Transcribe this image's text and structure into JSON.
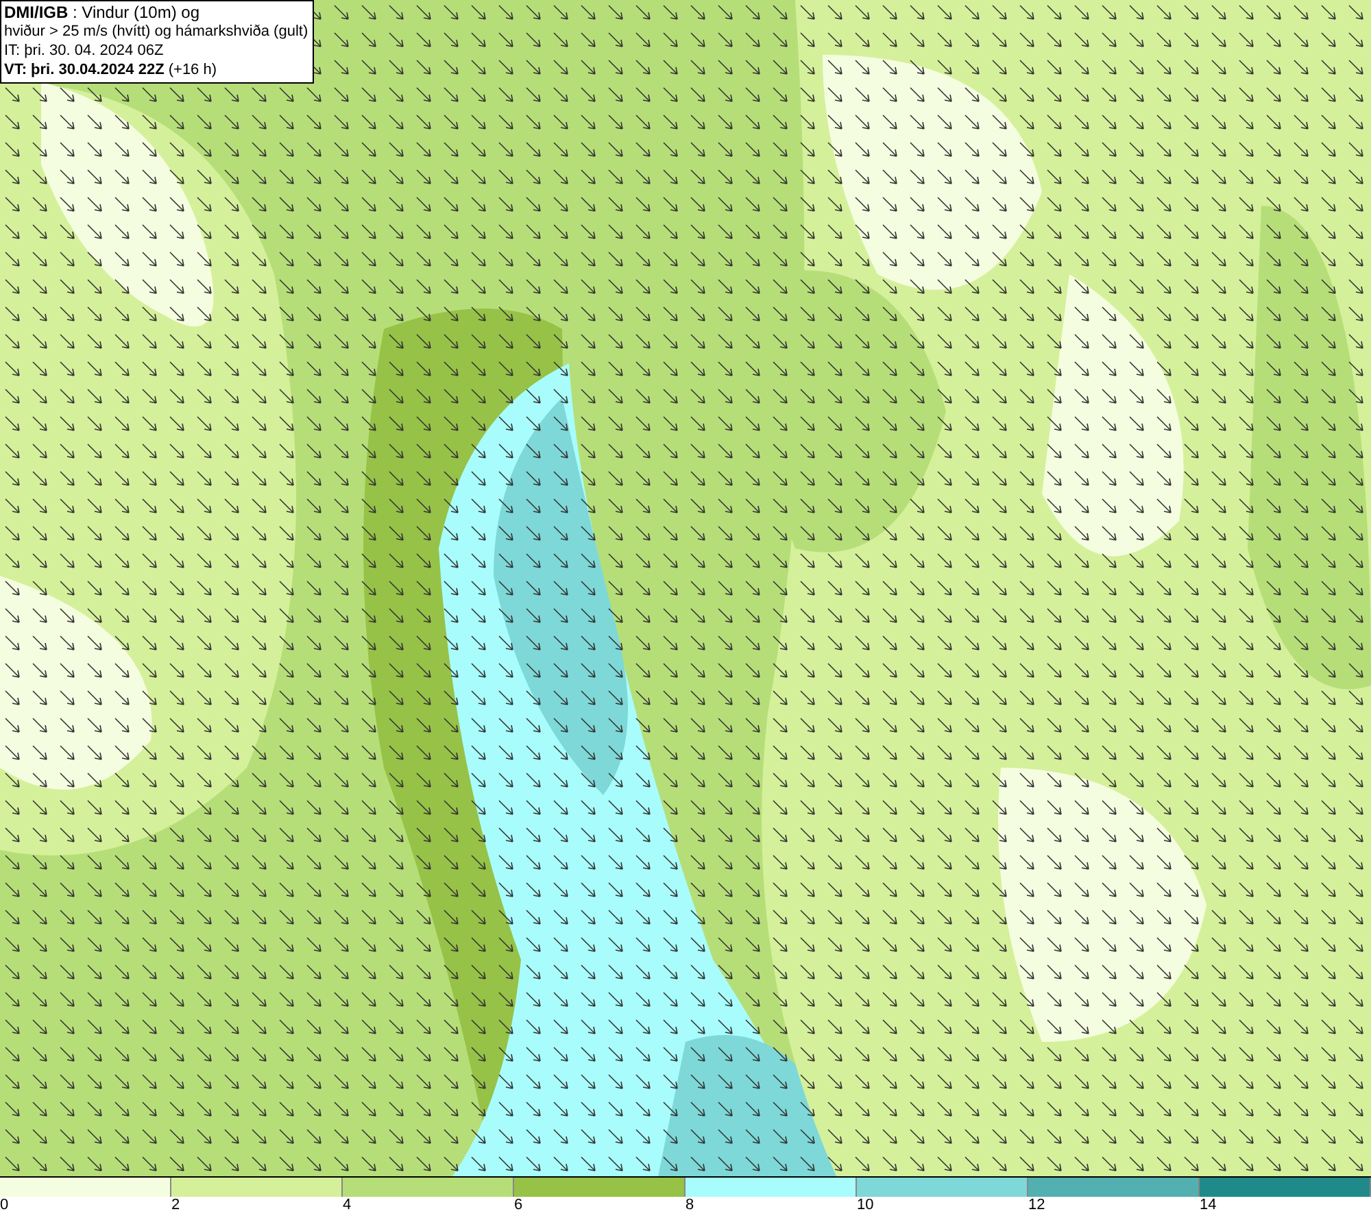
{
  "info_box": {
    "lines": [
      "**DMI/IGB** : Vindur (10m) og",
      "hviður > 25 m/s (hvítt) og hámarkshviða (gult)",
      "IT: þri. 30. 04. 2024 06Z",
      "**VT: þri. 30.04.2024 22Z** (+16 h)"
    ]
  },
  "legend": {
    "bins": [
      {
        "label": "0",
        "color": "#f5fde0"
      },
      {
        "label": "2",
        "color": "#d5f09a"
      },
      {
        "label": "4",
        "color": "#b6de78"
      },
      {
        "label": "6",
        "color": "#96c247"
      },
      {
        "label": "8",
        "color": "#a8fcfc"
      },
      {
        "label": "10",
        "color": "#7ed8d8"
      },
      {
        "label": "12",
        "color": "#52b0b0"
      },
      {
        "label": "14",
        "color": "#208a8a"
      }
    ]
  }
}
